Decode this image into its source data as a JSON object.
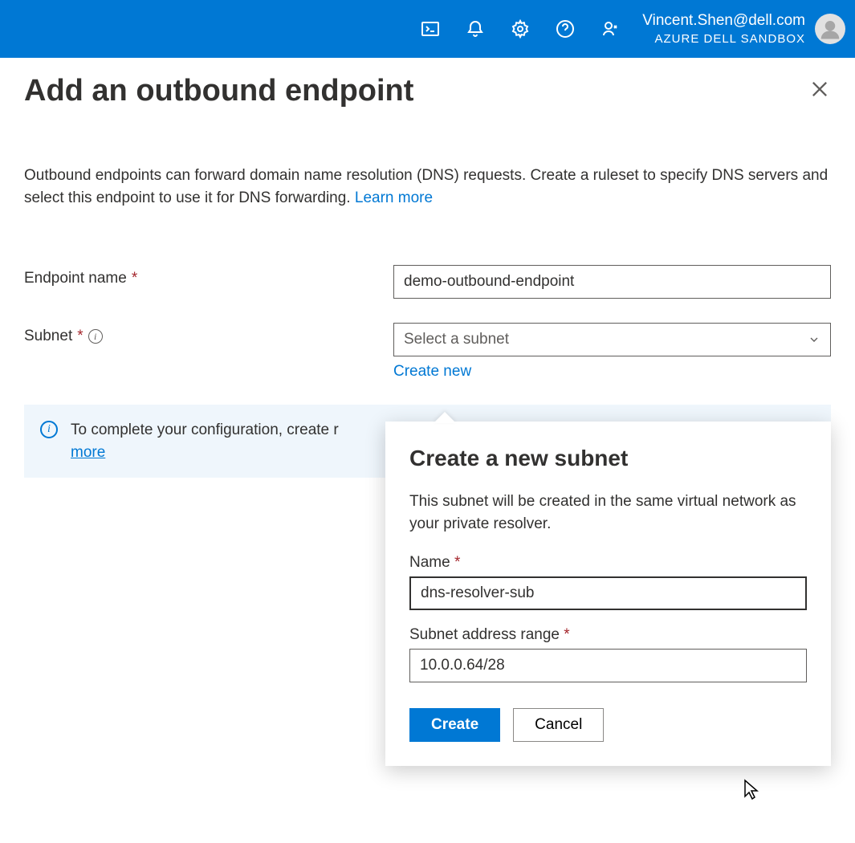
{
  "header": {
    "user_email": "Vincent.Shen@dell.com",
    "tenant_name": "AZURE DELL SANDBOX"
  },
  "page": {
    "title": "Add an outbound endpoint",
    "description_prefix": "Outbound endpoints can forward domain name resolution (DNS) requests. Create a ruleset to specify DNS servers and select this endpoint to use it for DNS forwarding. ",
    "learn_more": "Learn more"
  },
  "form": {
    "endpoint_name_label": "Endpoint name",
    "endpoint_name_value": "demo-outbound-endpoint",
    "subnet_label": "Subnet",
    "subnet_placeholder": "Select a subnet",
    "create_new_link": "Create new"
  },
  "info_banner": {
    "text_prefix": "To complete your configuration, create r",
    "learn_more": "more"
  },
  "popover": {
    "title": "Create a new subnet",
    "description": "This subnet will be created in the same virtual network as your private resolver.",
    "name_label": "Name",
    "name_value": "dns-resolver-sub",
    "range_label": "Subnet address range",
    "range_value": "10.0.0.64/28",
    "create_label": "Create",
    "cancel_label": "Cancel"
  }
}
